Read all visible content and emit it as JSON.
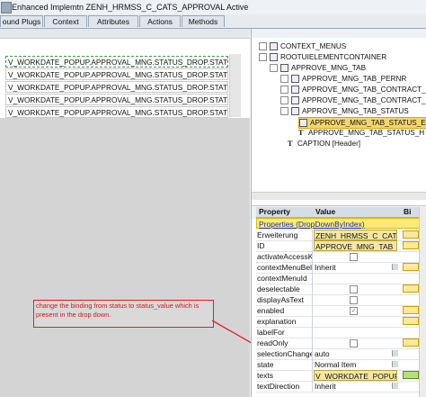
{
  "window": {
    "title": "Enhanced Implemtn ZENH_HRMSS_C_CATS_APPROVAL Active"
  },
  "tabs": [
    "ound Plugs",
    "Context",
    "Attributes",
    "Actions",
    "Methods"
  ],
  "bindings": [
    "V_WORKDATE_POPUP.APPROVAL_MNG.STATUS_DROP.STATUS_VALUE",
    "V_WORKDATE_POPUP.APPROVAL_MNG.STATUS_DROP.STATUS_VALUE",
    "V_WORKDATE_POPUP.APPROVAL_MNG.STATUS_DROP.STATUS_VALUE",
    "V_WORKDATE_POPUP.APPROVAL_MNG.STATUS_DROP.STATUS_VALUE",
    "V_WORKDATE_POPUP.APPROVAL_MNG.STATUS_DROP.STATUS_VALUE"
  ],
  "annotation": "change the binding from status to status_value which is present in the drop down.",
  "tree": [
    {
      "label": "CONTEXT_MENUS",
      "kind": "node"
    },
    {
      "label": "ROOTUIELEMENTCONTAINER",
      "kind": "node"
    },
    {
      "label": "APPROVE_MNG_TAB",
      "kind": "node"
    },
    {
      "label": "APPROVE_MNG_TAB_PERNR",
      "kind": "node"
    },
    {
      "label": "APPROVE_MNG_TAB_CONTRACT_SE",
      "kind": "node"
    },
    {
      "label": "APPROVE_MNG_TAB_CONTRACT_NA",
      "kind": "node"
    },
    {
      "label": "APPROVE_MNG_TAB_STATUS",
      "kind": "node"
    },
    {
      "label": "APPROVE_MNG_TAB_STATUS_E",
      "kind": "node"
    },
    {
      "label": "APPROVE_MNG_TAB_STATUS_H",
      "kind": "text"
    },
    {
      "label": "CAPTION [Header]",
      "kind": "text"
    }
  ],
  "properties": {
    "header": {
      "property": "Property",
      "value": "Value",
      "binding": "Bi"
    },
    "section": "Properties (DropDownByIndex)",
    "rows": [
      {
        "name": "Erweiterung",
        "value": "ZENH_HRMSS_C_CATS_",
        "style": "boxed"
      },
      {
        "name": "ID",
        "value": "APPROVE_MNG_TAB_ST",
        "style": "boxed"
      },
      {
        "name": "activateAccessK",
        "value": "",
        "style": "check"
      },
      {
        "name": "contextMenuBel",
        "value": "Inherit",
        "style": "dd"
      },
      {
        "name": "contextMenuId",
        "value": "",
        "style": "plain"
      },
      {
        "name": "deselectable",
        "value": "",
        "style": "check"
      },
      {
        "name": "displayAsText",
        "value": "",
        "style": "check"
      },
      {
        "name": "enabled",
        "value": "✓",
        "style": "check"
      },
      {
        "name": "explanation",
        "value": "",
        "style": "plain"
      },
      {
        "name": "labelFor",
        "value": "",
        "style": "plain"
      },
      {
        "name": "readOnly",
        "value": "",
        "style": "check"
      },
      {
        "name": "selectionChange",
        "value": "auto",
        "style": "dd"
      },
      {
        "name": "state",
        "value": "Normal Item",
        "style": "dd"
      },
      {
        "name": "texts",
        "value": "V_WORKDATE_POPUP.",
        "style": "boxed"
      },
      {
        "name": "textDirection",
        "value": "Inherit",
        "style": "dd"
      }
    ]
  },
  "colors": {
    "annotation": "#d01818",
    "highlight": "#f7d66b",
    "binding_button": "#ffe89a"
  }
}
